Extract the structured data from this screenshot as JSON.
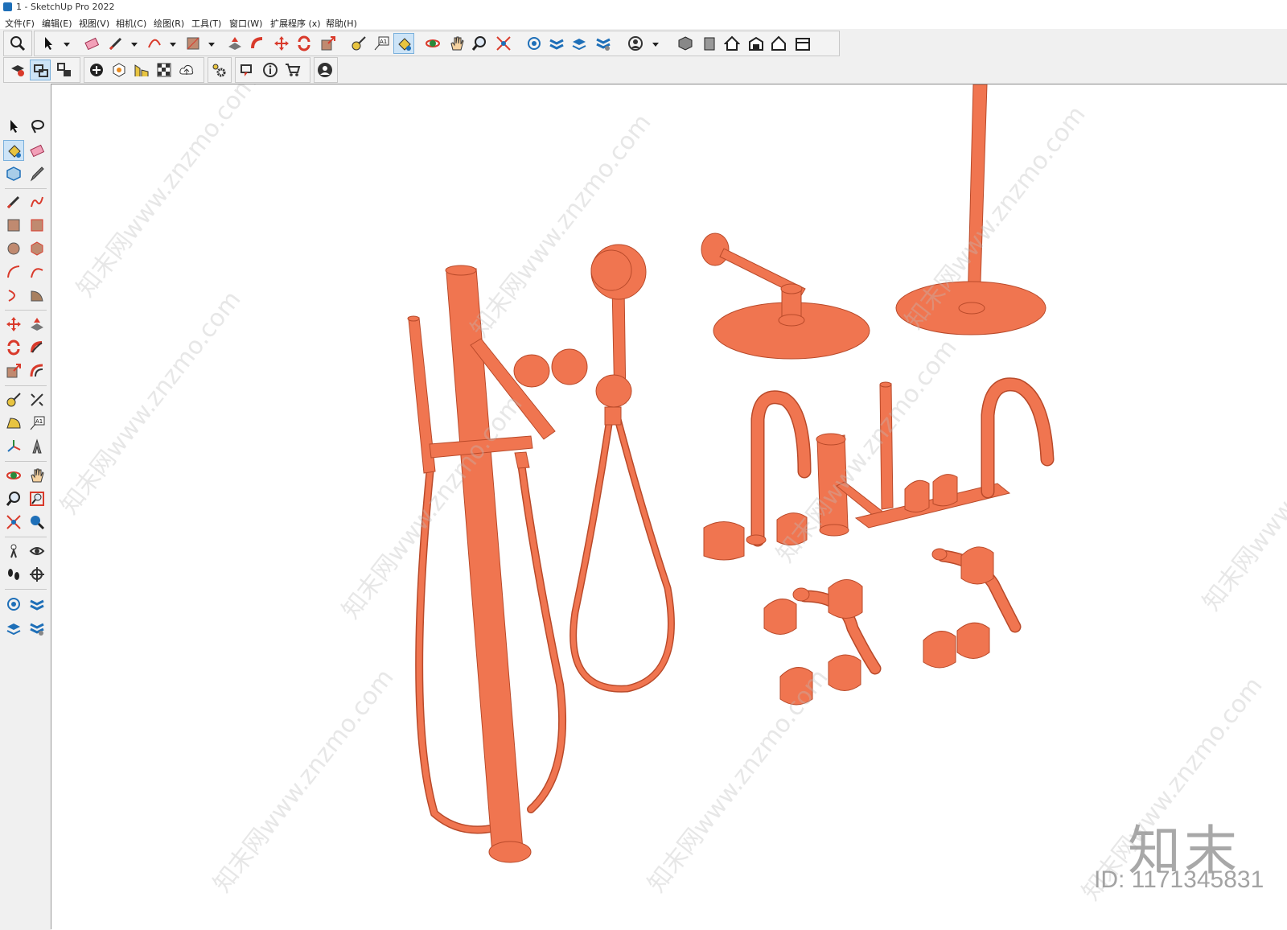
{
  "window": {
    "title": "1 - SketchUp Pro 2022"
  },
  "menu": [
    {
      "label": "文件(F)"
    },
    {
      "label": "编辑(E)"
    },
    {
      "label": "视图(V)"
    },
    {
      "label": "相机(C)"
    },
    {
      "label": "绘图(R)"
    },
    {
      "label": "工具(T)"
    },
    {
      "label": "窗口(W)"
    },
    {
      "label": "扩展程序 (x)"
    },
    {
      "label": "帮助(H)"
    }
  ],
  "toolbar": {
    "text_tool_label": "A1",
    "sidebar_text_label": "A1"
  },
  "watermark": {
    "repeat_text": "知末网www.znzmo.com",
    "logo": "知末",
    "id": "ID: 1171345831"
  },
  "colors": {
    "model": "#f07550",
    "model_edge": "#b94a2a",
    "accent": "#d93a2b",
    "blue": "#1e6fb8"
  }
}
